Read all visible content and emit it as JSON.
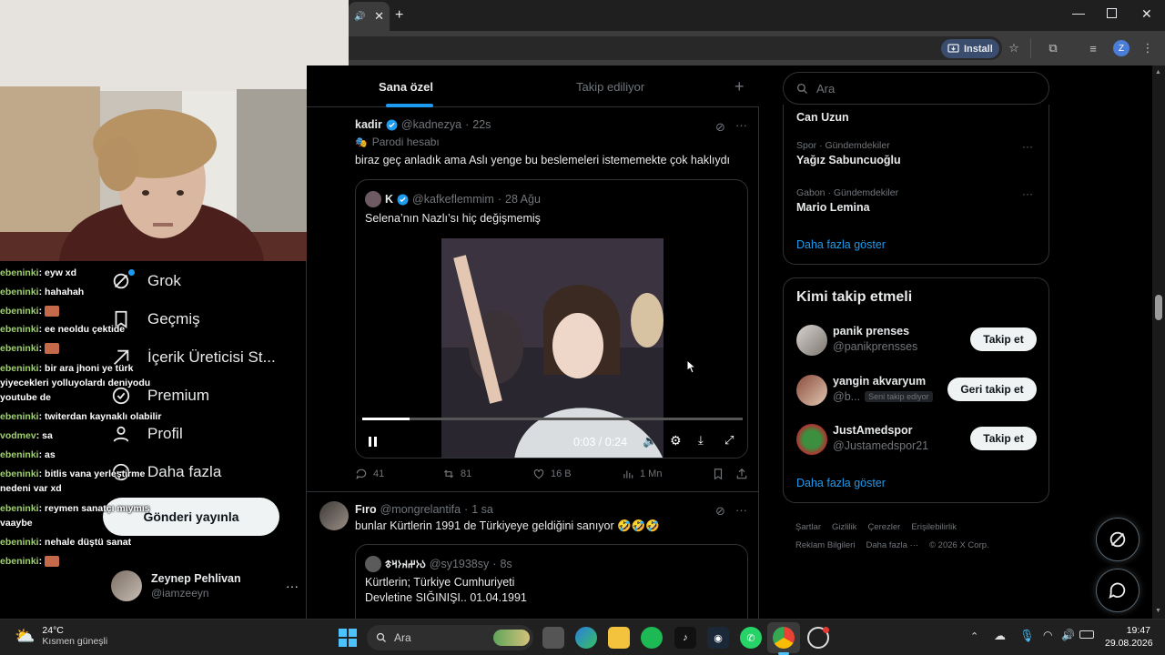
{
  "browser": {
    "install_label": "Install",
    "profile_initial": "Z",
    "window_controls": [
      "minimize-icon",
      "maximize-icon",
      "close-icon"
    ],
    "accent": "#3a4d6e"
  },
  "stream_chat": [
    {
      "user": "ebeninki",
      "msg": "eyw xd"
    },
    {
      "user": "ebeninki",
      "msg": "hahahah"
    },
    {
      "user": "ebeninki",
      "msg": "",
      "emote": true
    },
    {
      "user": "ebeninki",
      "msg": "ee neoldu çektide"
    },
    {
      "user": "ebeninki",
      "msg": "",
      "emote": true
    },
    {
      "user": "ebeninki",
      "msg": "bir ara jhoni ye türk yiyecekleri yolluyolardı deniyodu youtube de"
    },
    {
      "user": "ebeninki",
      "msg": "twiterdan kaynaklı olabilir"
    },
    {
      "user": "vodmev",
      "msg": "sa"
    },
    {
      "user": "ebeninki",
      "msg": "as"
    },
    {
      "user": "ebeninki",
      "msg": "bitlis vana yerleştirme nedeni var xd"
    },
    {
      "user": "ebeninki",
      "msg": "reymen sanatçı mıymış vaaybe"
    },
    {
      "user": "ebeninki",
      "msg": "nehale düştü sanat"
    },
    {
      "user": "ebeninki",
      "msg": "",
      "emote": true
    }
  ],
  "nav": {
    "items": [
      {
        "label": "Grok",
        "icon": "grok-icon"
      },
      {
        "label": "Geçmiş",
        "icon": "bookmark-icon"
      },
      {
        "label": "İçerik Üreticisi St...",
        "icon": "creator-studio-icon"
      },
      {
        "label": "Premium",
        "icon": "premium-icon"
      },
      {
        "label": "Profil",
        "icon": "profile-icon"
      },
      {
        "label": "Daha fazla",
        "icon": "more-circle-icon"
      }
    ],
    "post_label": "Gönderi yayınla",
    "account": {
      "name": "Zeynep Pehlivan",
      "handle": "@iamzeeyn"
    }
  },
  "feed": {
    "tabs": [
      "Sana özel",
      "Takip ediliyor"
    ],
    "tweet1": {
      "name": "kadir",
      "handle": "@kadnezya",
      "time": "22s",
      "parody": "Parodi hesabı",
      "text": "biraz geç anladık ama Aslı yenge bu beslemeleri istememekte çok haklıydı",
      "quote": {
        "name": "K",
        "handle": "@kafkeflemmim",
        "time": "28 Ağu",
        "text": "Selena’nın Nazlı’sı hiç değişmemiş",
        "video_time": "0:03 / 0:24",
        "progress": 0.125
      },
      "stats": {
        "replies": "41",
        "reposts": "81",
        "likes": "16 B",
        "views": "1 Mn"
      }
    },
    "tweet2": {
      "name": "Fıro",
      "handle": "@mongrelantifa",
      "time": "1 sa",
      "text": "bunlar Kürtlerin 1991 de Türkiyeye geldiğini sanıyor 🤣🤣🤣",
      "quote": {
        "name": "𐰉𐰆𐰔𐰴𐰆𐰺𐱃",
        "handle": "@sy1938sy",
        "time": "8s",
        "line1": "Kürtlerin; Türkiye Cumhuriyeti",
        "line2": "Devletine SIĞINIŞI.. 01.04.1991"
      }
    }
  },
  "right": {
    "search_placeholder": "Ara",
    "trends": [
      {
        "category": "",
        "name": "Can Uzun"
      },
      {
        "category": "Spor · Gündemdekiler",
        "name": "Yağız Sabuncuoğlu"
      },
      {
        "category": "Gabon · Gündemdekiler",
        "name": "Mario Lemina"
      }
    ],
    "show_more": "Daha fazla göster",
    "who_to_follow_title": "Kimi takip etmeli",
    "follows": [
      {
        "name": "panik prenses",
        "handle": "@panikprensses",
        "button": "Takip et",
        "badge": ""
      },
      {
        "name": "yangin akvaryum",
        "handle": "@b...",
        "button": "Geri takip et",
        "badge": "Seni takip ediyor"
      },
      {
        "name": "JustAmedspor",
        "handle": "@Justamedspor21",
        "button": "Takip et",
        "badge": ""
      }
    ],
    "footer": {
      "row1": [
        "Şartlar",
        "Gizlilik",
        "Çerezler",
        "Erişilebilirlik"
      ],
      "row2": [
        "Reklam Bilgileri",
        "Daha fazla ···",
        "© 2026 X Corp."
      ]
    }
  },
  "taskbar": {
    "weather_temp": "24°C",
    "weather_desc": "Kısmen güneşli",
    "search_placeholder": "Ara",
    "time": "19:47",
    "date": "29.08.2026"
  }
}
